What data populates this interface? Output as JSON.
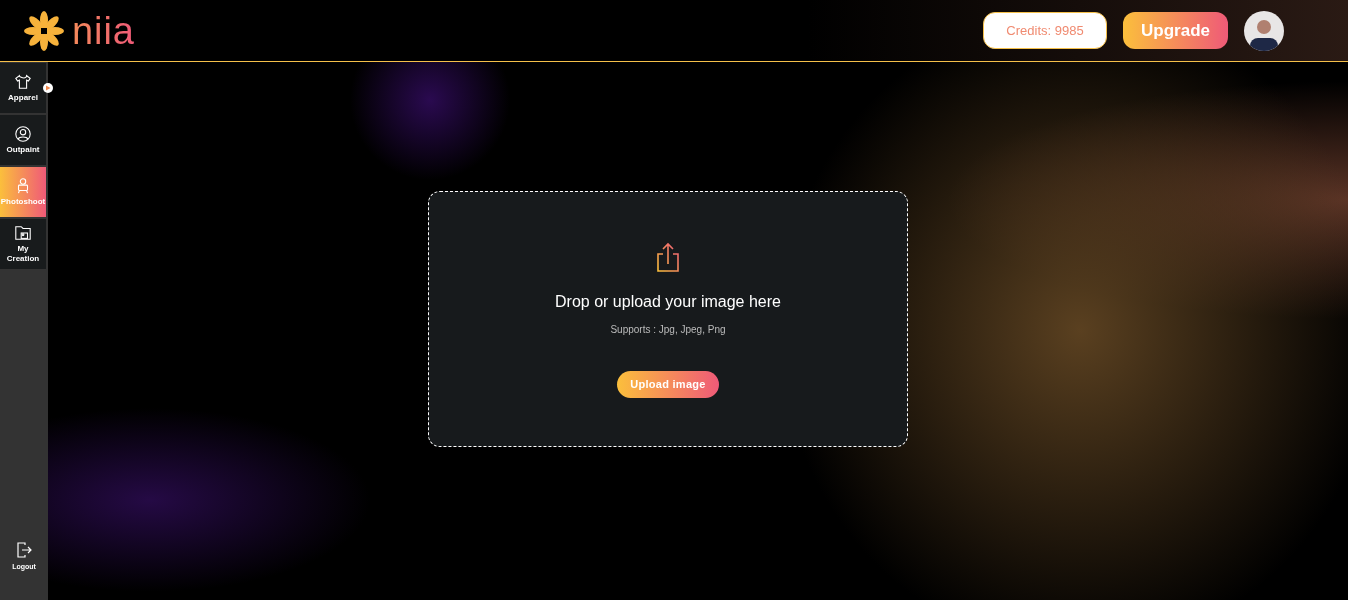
{
  "header": {
    "logo": "niia",
    "credits": "Credits: 9985",
    "upgrade": "Upgrade"
  },
  "sidebar": {
    "items": [
      {
        "label": "Apparel",
        "selected": false
      },
      {
        "label": "Outpaint",
        "selected": false
      },
      {
        "label": "Photoshoot",
        "selected": true
      },
      {
        "label": "My Creation",
        "selected": false
      }
    ],
    "logout": "Logout"
  },
  "upload": {
    "title": "Drop or upload your image here",
    "hint": "Supports : Jpg, Jpeg, Png",
    "button": "Upload image"
  }
}
